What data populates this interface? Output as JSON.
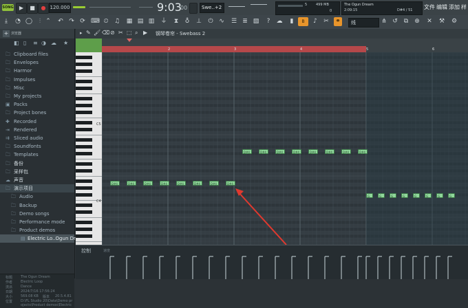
{
  "transport": {
    "song_badge": "SONG",
    "tempo": "120.000",
    "time": "9:03",
    "time_sub": "00",
    "pattern": "Swe..+2",
    "cpu": "5",
    "memory": "499 MB",
    "voices": "0",
    "hint_title": "The Ogun Dream",
    "hint_time": "2:09:15",
    "hint_note": "D#4 / 51",
    "menu": [
      "文件",
      "编辑",
      "添加",
      "样",
      "滚"
    ]
  },
  "toolbar": {
    "snap": "线"
  },
  "browser": {
    "header_label": "浏览器",
    "items": [
      {
        "label": "Clipboard files",
        "icon": "folder-icon"
      },
      {
        "label": "Envelopes",
        "icon": "folder-icon"
      },
      {
        "label": "Harmor",
        "icon": "folder-icon"
      },
      {
        "label": "Impulses",
        "icon": "folder-icon"
      },
      {
        "label": "Misc",
        "icon": "folder-icon"
      },
      {
        "label": "My projects",
        "icon": "folder-icon"
      },
      {
        "label": "Packs",
        "icon": "packs-icon"
      },
      {
        "label": "Project bones",
        "icon": "folder-icon"
      },
      {
        "label": "Recorded",
        "icon": "recorded-icon"
      },
      {
        "label": "Rendered",
        "icon": "rendered-icon"
      },
      {
        "label": "Sliced audio",
        "icon": "sliced-audio-icon"
      },
      {
        "label": "Soundfonts",
        "icon": "folder-icon"
      },
      {
        "label": "Templates",
        "icon": "folder-icon"
      },
      {
        "label": "备份",
        "icon": "folder-icon"
      },
      {
        "label": "采样包",
        "icon": "folder-icon"
      },
      {
        "label": "声音",
        "icon": "sound-icon"
      },
      {
        "label": "演示项目",
        "icon": "folder-icon"
      },
      {
        "label": "Audio",
        "icon": "folder-icon"
      },
      {
        "label": "Backup",
        "icon": "folder-icon"
      },
      {
        "label": "Demo songs",
        "icon": "folder-icon"
      },
      {
        "label": "Performance mode",
        "icon": "folder-icon"
      },
      {
        "label": "Product demos",
        "icon": "folder-icon"
      },
      {
        "label": "Electric Lo..Ogun Dream",
        "icon": "file-icon"
      }
    ],
    "info": {
      "labels": [
        "标题",
        "作者",
        "流派",
        "日期",
        "大小",
        "位置"
      ],
      "title": "The Ogun Dream",
      "author": "Electric Loop",
      "genre": "Dance",
      "date": "2024/7/16 17:56:24",
      "size": "569.08 KB",
      "size_label": "版本",
      "version": "20.5.4.81",
      "location": "D:\\FL Studio 20\\Data\\Demo projects\\Product demos\\Electric"
    }
  },
  "piano_roll": {
    "title": "钢琴卷帘 - Swebass 2",
    "bar_numbers": [
      "2",
      "3",
      "4",
      "5",
      "6"
    ],
    "key_labels": [
      "C5",
      "C4"
    ],
    "controller_label": "控制",
    "controller_sub": "速度",
    "notes_upper": [
      "D#4",
      "D#4",
      "D#4",
      "D#4",
      "D#4",
      "D#4",
      "D#4",
      "D#4"
    ],
    "notes_mid": [
      "D#4",
      "D#4",
      "D#4",
      "D#4",
      "D#4",
      "D#4",
      "D#4",
      "D#4"
    ],
    "notes_right": [
      "G",
      "G",
      "G",
      "G",
      "G",
      "G",
      "G",
      "G"
    ]
  },
  "colors": {
    "accent_green": "#8fd79a",
    "loop_red": "#b5484a",
    "arrow_red": "#e0392f",
    "badge_green": "#8fbf3b"
  }
}
